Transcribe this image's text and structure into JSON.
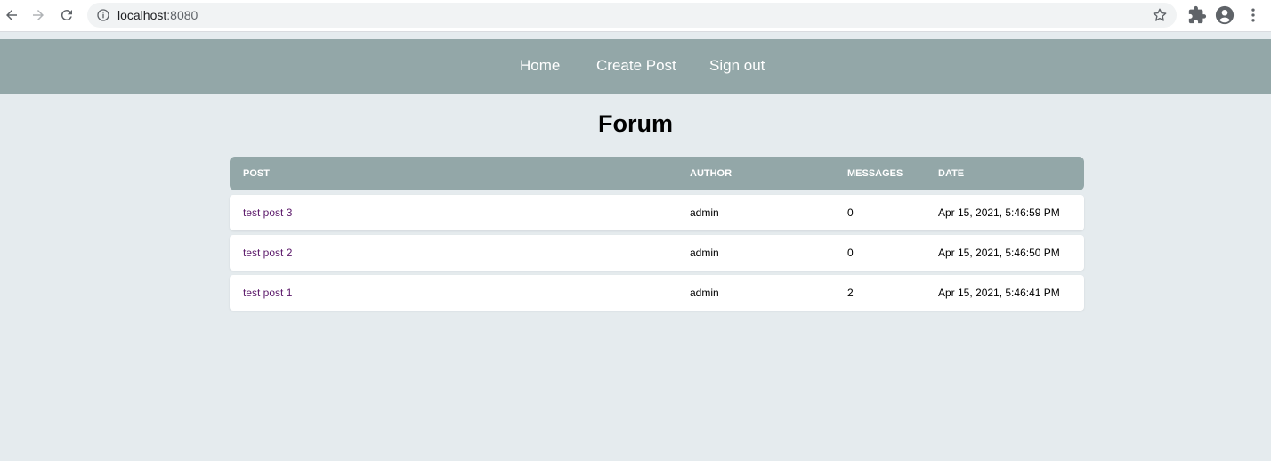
{
  "browser": {
    "url_host": "localhost",
    "url_port": ":8080"
  },
  "nav": {
    "items": [
      {
        "label": "Home"
      },
      {
        "label": "Create Post"
      },
      {
        "label": "Sign out"
      }
    ]
  },
  "page": {
    "title": "Forum"
  },
  "table": {
    "headers": {
      "post": "POST",
      "author": "AUTHOR",
      "messages": "MESSAGES",
      "date": "DATE"
    },
    "rows": [
      {
        "post": "test post 3",
        "author": "admin",
        "messages": "0",
        "date": "Apr 15, 2021, 5:46:59 PM"
      },
      {
        "post": "test post 2",
        "author": "admin",
        "messages": "0",
        "date": "Apr 15, 2021, 5:46:50 PM"
      },
      {
        "post": "test post 1",
        "author": "admin",
        "messages": "2",
        "date": "Apr 15, 2021, 5:46:41 PM"
      }
    ]
  },
  "colors": {
    "header_bg": "#93a7a8",
    "page_bg": "#e5ebee",
    "link": "#5c1a6b"
  }
}
